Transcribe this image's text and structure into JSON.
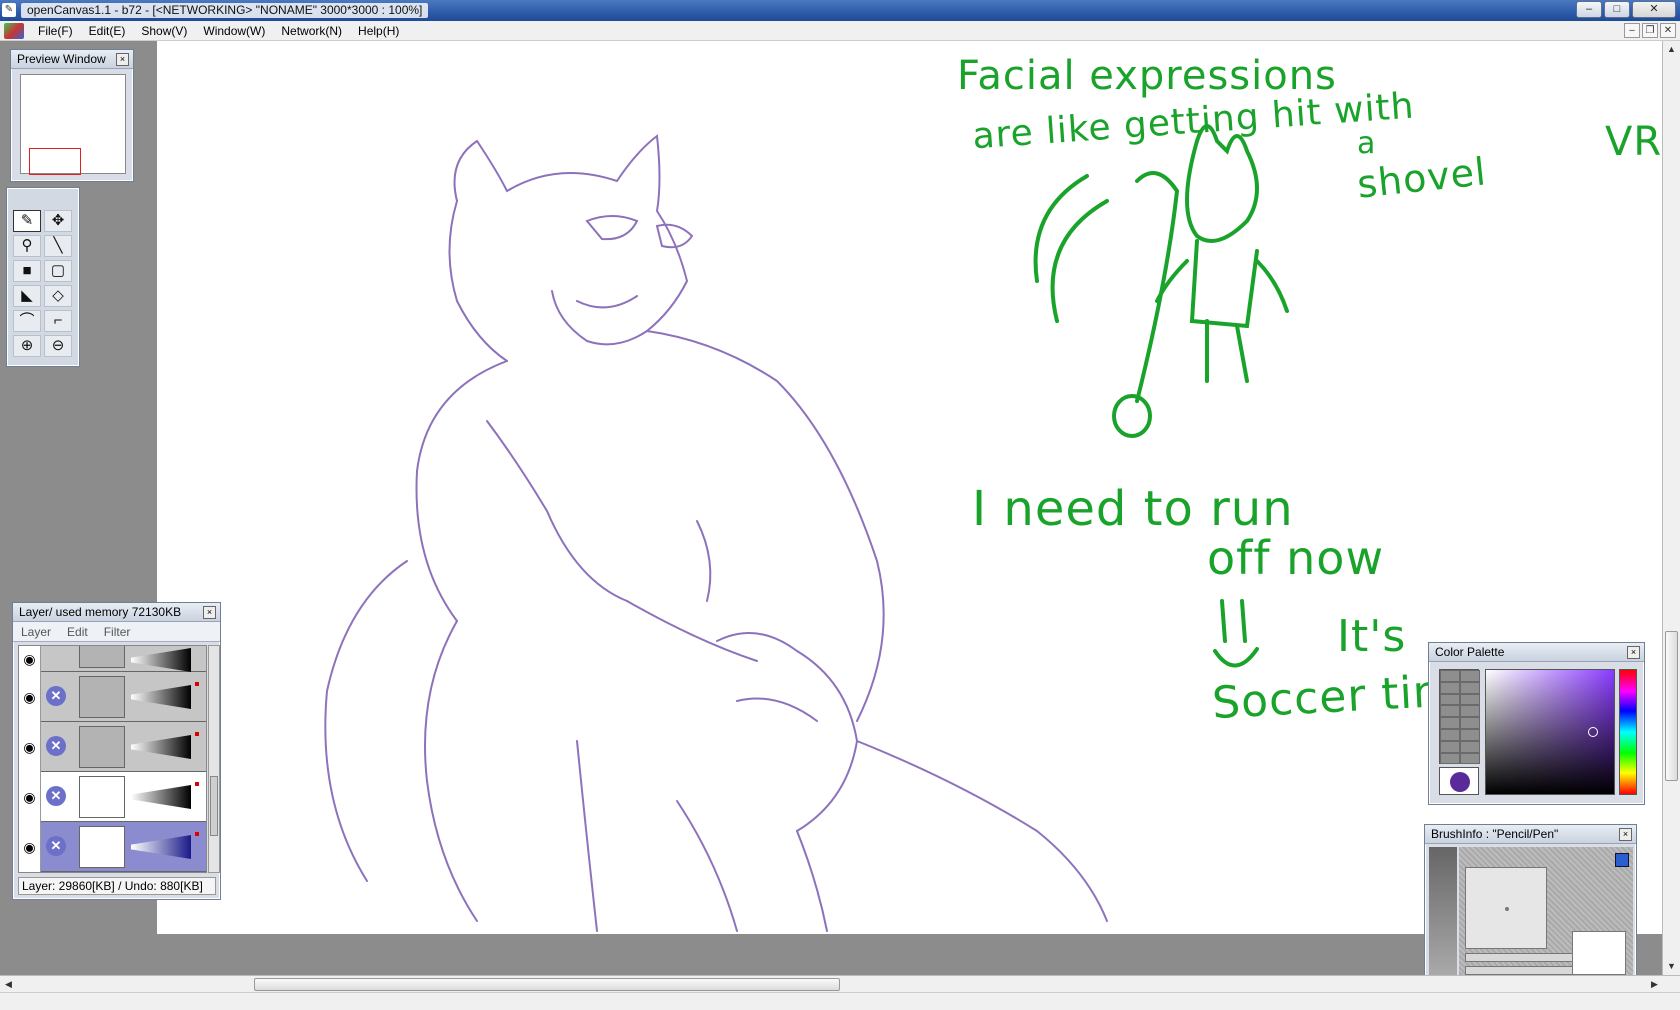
{
  "window": {
    "title": "openCanvas1.1 - b72 - [<NETWORKING>  \"NONAME\" 3000*3000 : 100%]",
    "buttons": {
      "minimize": "–",
      "maximize": "□",
      "close": "✕"
    }
  },
  "menu": {
    "items": [
      "File(F)",
      "Edit(E)",
      "Show(V)",
      "Window(W)",
      "Network(N)",
      "Help(H)"
    ],
    "mdi_buttons": {
      "minimize": "–",
      "restore": "❐",
      "close": "✕"
    }
  },
  "preview_window": {
    "title": "Preview Window",
    "close": "×"
  },
  "tools": {
    "icons": [
      "pencil-icon",
      "move-icon",
      "dropper-icon",
      "line-icon",
      "fill-rect-icon",
      "select-rect-icon",
      "fill-lasso-icon",
      "lasso-icon",
      "curve-icon",
      "polyline-icon",
      "zoom-in-icon",
      "zoom-out-icon"
    ],
    "glyphs": [
      "✎",
      "✥",
      "⚲",
      "╲",
      "■",
      "▢",
      "◣",
      "◇",
      "⌒",
      "⌐",
      "⊕",
      "⊖"
    ]
  },
  "layer_panel": {
    "title": "Layer/ used memory 72130KB",
    "close": "×",
    "menu": [
      "Layer",
      "Edit",
      "Filter"
    ],
    "status": "Layer: 29860[KB] / Undo: 880[KB]",
    "delete_glyph": "✕",
    "eye_glyph": "◉"
  },
  "color_palette": {
    "title": "Color Palette",
    "close": "×",
    "current_color": "#5a2a9a",
    "hue_color": "#8a3cff"
  },
  "brush_info": {
    "title": "BrushInfo : \"Pencil/Pen\"",
    "close": "×"
  },
  "canvas": {
    "sketch_color": "#7a5ab0",
    "annotation_color": "#1aa32a",
    "annotations": {
      "line1": "Facial expressions",
      "line2": "are like getting hit with",
      "line3": "a",
      "line4": "shovel",
      "corner": "VRo",
      "line5": "I need to run",
      "line6": "off now",
      "line7": "It's",
      "line8": "Soccer time"
    }
  },
  "scrollbars": {
    "left": "◀",
    "right": "▶",
    "up": "▲",
    "down": "▼"
  }
}
